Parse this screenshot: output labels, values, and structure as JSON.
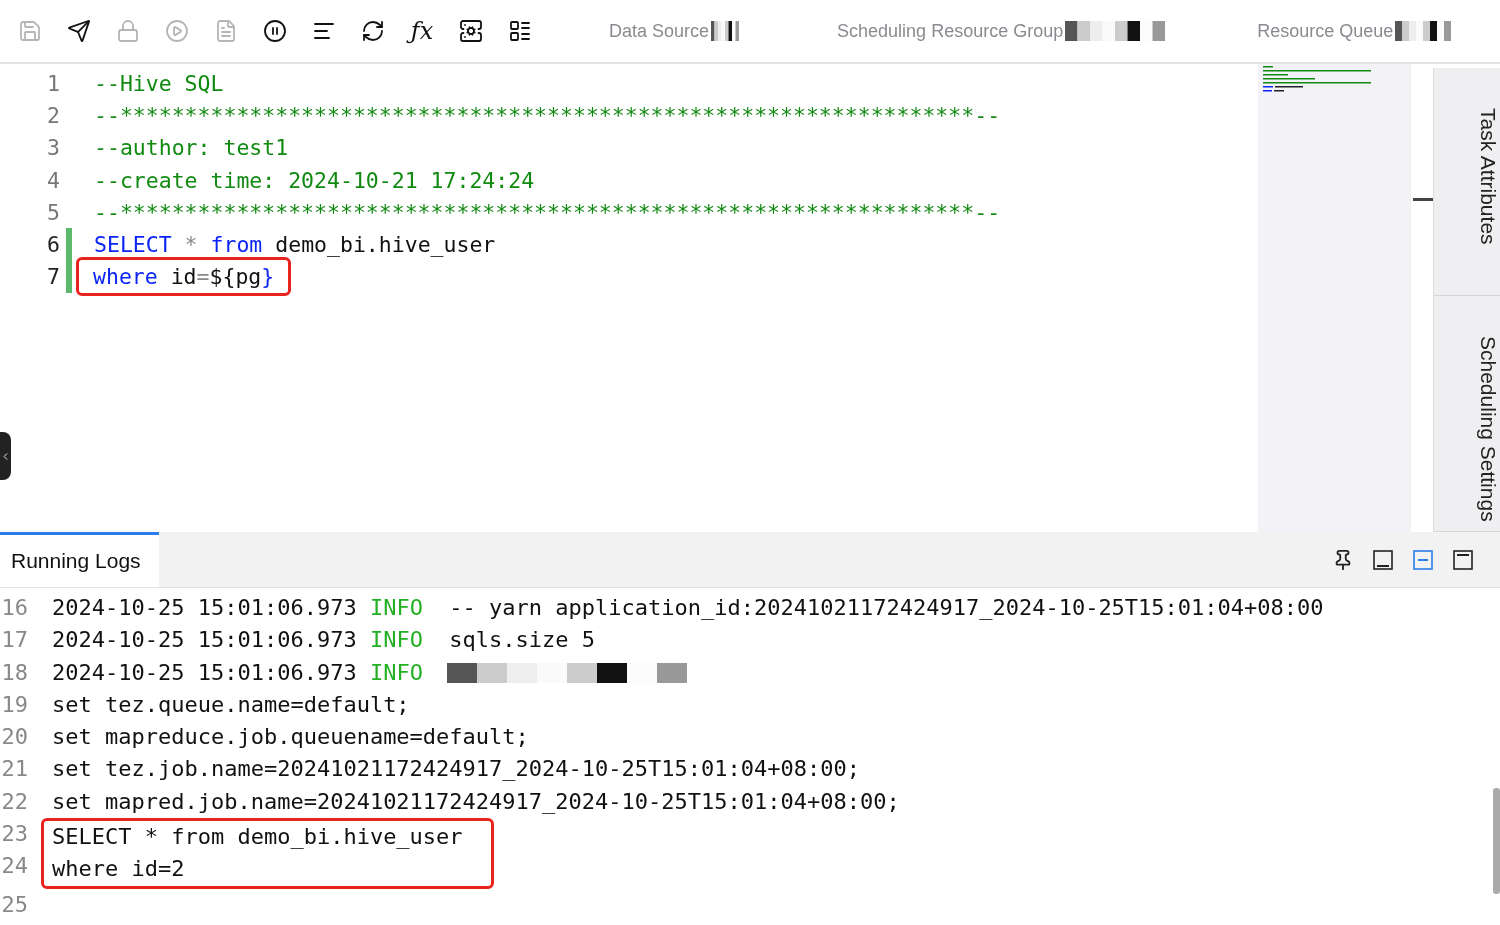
{
  "toolbar": {
    "buttons": [
      {
        "disabled": true
      },
      {
        "disabled": false
      },
      {
        "disabled": true
      },
      {
        "disabled": true
      },
      {
        "disabled": true
      },
      {
        "disabled": false
      },
      {
        "disabled": false
      },
      {
        "disabled": false
      },
      {
        "disabled": false,
        "label": "ƒx"
      },
      {
        "disabled": false
      },
      {
        "disabled": false
      }
    ],
    "selectors": [
      {
        "label": "Data Source"
      },
      {
        "label": "Scheduling Resource Group"
      },
      {
        "label": "Resource Queue"
      }
    ]
  },
  "editor": {
    "lines": [
      {
        "number": "1",
        "changed": false,
        "boxed": false,
        "tokens": [
          {
            "text": "--Hive SQL",
            "kind": "comment"
          }
        ]
      },
      {
        "number": "2",
        "changed": false,
        "boxed": false,
        "tokens": [
          {
            "text": "--******************************************************************--",
            "kind": "comment"
          }
        ]
      },
      {
        "number": "3",
        "changed": false,
        "boxed": false,
        "tokens": [
          {
            "text": "--author: test1",
            "kind": "comment"
          }
        ]
      },
      {
        "number": "4",
        "changed": false,
        "boxed": false,
        "tokens": [
          {
            "text": "--create time: 2024-10-21 17:24:24",
            "kind": "comment"
          }
        ]
      },
      {
        "number": "5",
        "changed": false,
        "boxed": false,
        "tokens": [
          {
            "text": "--******************************************************************--",
            "kind": "comment"
          }
        ]
      },
      {
        "number": "6",
        "changed": true,
        "boxed": false,
        "tokens": [
          {
            "text": "SELECT",
            "kind": "keyword"
          },
          {
            "text": " * ",
            "kind": "operator"
          },
          {
            "text": "from",
            "kind": "keyword"
          },
          {
            "text": " demo_bi.hive_user",
            "kind": "plain"
          }
        ]
      },
      {
        "number": "7",
        "changed": true,
        "boxed": true,
        "tokens": [
          {
            "text": "where",
            "kind": "keyword"
          },
          {
            "text": " id",
            "kind": "plain"
          },
          {
            "text": "=",
            "kind": "operator"
          },
          {
            "text": "${pg",
            "kind": "plain"
          },
          {
            "text": "}",
            "kind": "keyword"
          }
        ]
      }
    ]
  },
  "side_tabs": [
    {
      "label": "Task Attributes"
    },
    {
      "label": "Scheduling Settings"
    }
  ],
  "log_panel": {
    "tabs": [
      {
        "label": "Running Logs",
        "selected": true
      }
    ],
    "view_buttons": [
      {
        "selected": false
      },
      {
        "selected": false
      },
      {
        "selected": true
      },
      {
        "selected": false
      }
    ],
    "lines": [
      {
        "number": "16",
        "kind": "info",
        "time": "2024-10-25 15:01:06.973",
        "level": "INFO",
        "text": "-- yarn application_id:20241021172424917_2024-10-25T15:01:04+08:00",
        "redacted": false,
        "boxed": false
      },
      {
        "number": "17",
        "kind": "info",
        "time": "2024-10-25 15:01:06.973",
        "level": "INFO",
        "text": "sqls.size 5",
        "redacted": false,
        "boxed": false
      },
      {
        "number": "18",
        "kind": "info",
        "time": "2024-10-25 15:01:06.973",
        "level": "INFO",
        "redacted": true,
        "boxed": false
      },
      {
        "number": "19",
        "kind": "plain",
        "text": "set tez.queue.name=default;",
        "boxed": false
      },
      {
        "number": "20",
        "kind": "plain",
        "text": "set mapreduce.job.queuename=default;",
        "boxed": false
      },
      {
        "number": "21",
        "kind": "plain",
        "text": "set tez.job.name=20241021172424917_2024-10-25T15:01:04+08:00;",
        "boxed": false
      },
      {
        "number": "22",
        "kind": "plain",
        "text": "set mapred.job.name=20241021172424917_2024-10-25T15:01:04+08:00;",
        "boxed": false
      },
      {
        "number": "23",
        "kind": "plain",
        "text": "SELECT * from demo_bi.hive_user",
        "boxed": true
      },
      {
        "number": "24",
        "kind": "plain",
        "text": "where id=2",
        "boxed": true
      },
      {
        "number": "25",
        "kind": "plain",
        "boxed": false
      }
    ]
  }
}
